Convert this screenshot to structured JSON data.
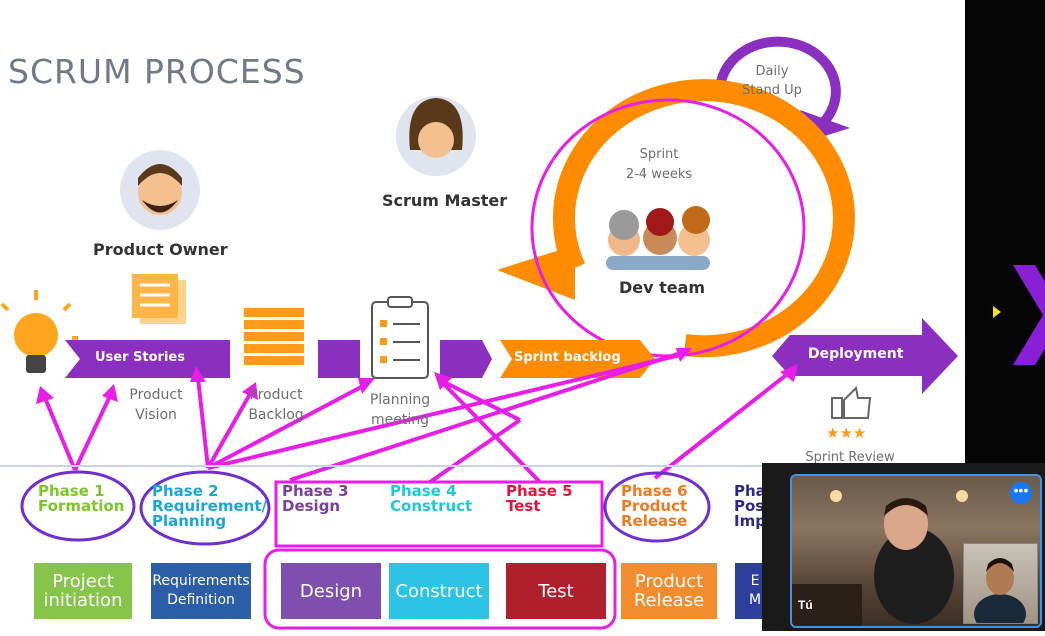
{
  "title": "SCRUM PROCESS",
  "roles": {
    "product_owner": "Product Owner",
    "scrum_master": "Scrum Master",
    "dev_team": "Dev team"
  },
  "cycle": {
    "daily_line1": "Daily",
    "daily_line2": "Stand Up",
    "sprint_line1": "Sprint",
    "sprint_line2": "2-4 weeks"
  },
  "flow": {
    "user_stories": "User Stories",
    "product_vision_1": "Product",
    "product_vision_2": "Vision",
    "product_backlog_1": "Product",
    "product_backlog_2": "Backlog",
    "planning_1": "Planning",
    "planning_2": "meeting",
    "sprint_backlog": "Sprint backlog",
    "deployment": "Deployment",
    "sprint_review": "Sprint Review",
    "stars": "★★★"
  },
  "phases": [
    {
      "l1": "Phase 1",
      "l2": "Formation",
      "l3": "",
      "color": "#7cc62b"
    },
    {
      "l1": "Phase 2",
      "l2": "Requirement/",
      "l3": "Planning",
      "color": "#1aa6d9"
    },
    {
      "l1": "Phase 3",
      "l2": "Design",
      "l3": "",
      "color": "#7b3f9e"
    },
    {
      "l1": "Phase 4",
      "l2": "Construct",
      "l3": "",
      "color": "#1ec8d8"
    },
    {
      "l1": "Phase 5",
      "l2": "Test",
      "l3": "",
      "color": "#e0173a"
    },
    {
      "l1": "Phase 6",
      "l2": "Product",
      "l3": "Release",
      "color": "#f07a22"
    },
    {
      "l1": "Pha",
      "l2": "Pos",
      "l3": "Imp",
      "color": "#2a2a8a"
    }
  ],
  "bottom_boxes": [
    {
      "l1": "Project",
      "l2": "initiation",
      "color": "#86c54a"
    },
    {
      "l1": "Requirements",
      "l2": "Definition",
      "color": "#2c5da8"
    },
    {
      "l1": "Design",
      "l2": "",
      "color": "#7f4fb0"
    },
    {
      "l1": "Construct",
      "l2": "",
      "color": "#2bc4e4"
    },
    {
      "l1": "Test",
      "l2": "",
      "color": "#b0202c"
    },
    {
      "l1": "Product",
      "l2": "Release",
      "color": "#f28c2e"
    },
    {
      "l1": "E",
      "l2": "M",
      "color": "#2c3f9a"
    }
  ],
  "video": {
    "caller_name": "Tú",
    "more_icon": "more-horizontal-icon"
  },
  "colors": {
    "purple": "#8a2fc0",
    "orange": "#ff8c00",
    "magenta": "#e81ee8"
  }
}
